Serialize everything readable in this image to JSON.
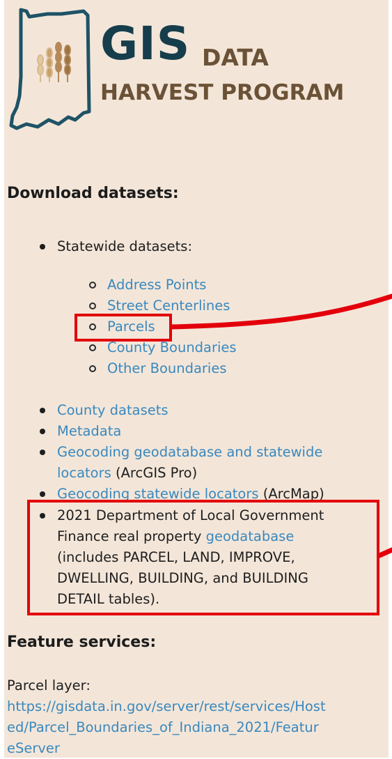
{
  "logo": {
    "gis": "GIS",
    "data": "DATA",
    "harvest": "HARVEST PROGRAM"
  },
  "download": {
    "heading": "Download datasets:",
    "statewide_label": "Statewide datasets:",
    "statewide_items": [
      "Address Points",
      "Street Centerlines",
      "Parcels",
      "County Boundaries",
      "Other Boundaries"
    ],
    "county_datasets": "County datasets",
    "metadata": "Metadata",
    "geocoding_pro_link_1": "Geocoding geodatabase and statewide",
    "geocoding_pro_link_2": "locators",
    "geocoding_pro_suffix": " (ArcGIS Pro)",
    "geocoding_arcmap_link": "Geocoding statewide locators",
    "geocoding_arcmap_suffix": " (ArcMap)",
    "dlgf_line1": "2021 Department of Local Government",
    "dlgf_line2_pre": "Finance real property ",
    "dlgf_line2_link": "geodatabase",
    "dlgf_line3": "(includes PARCEL, LAND, IMPROVE,",
    "dlgf_line4": "DWELLING, BUILDING, and BUILDING",
    "dlgf_line5": "DETAIL tables)."
  },
  "feature": {
    "heading": "Feature services:",
    "parcel_label": "Parcel layer:",
    "url_line1": "https://gisdata.in.gov/server/rest/services/Host",
    "url_line2": "ed/Parcel_Boundaries_of_Indiana_2021/Featur",
    "url_line3": "eServer"
  },
  "colors": {
    "background": "#f3e6d9",
    "link": "#3a88bd",
    "highlight": "#e3000b",
    "logo_dark": "#163d4c",
    "logo_brown": "#6b5237"
  }
}
